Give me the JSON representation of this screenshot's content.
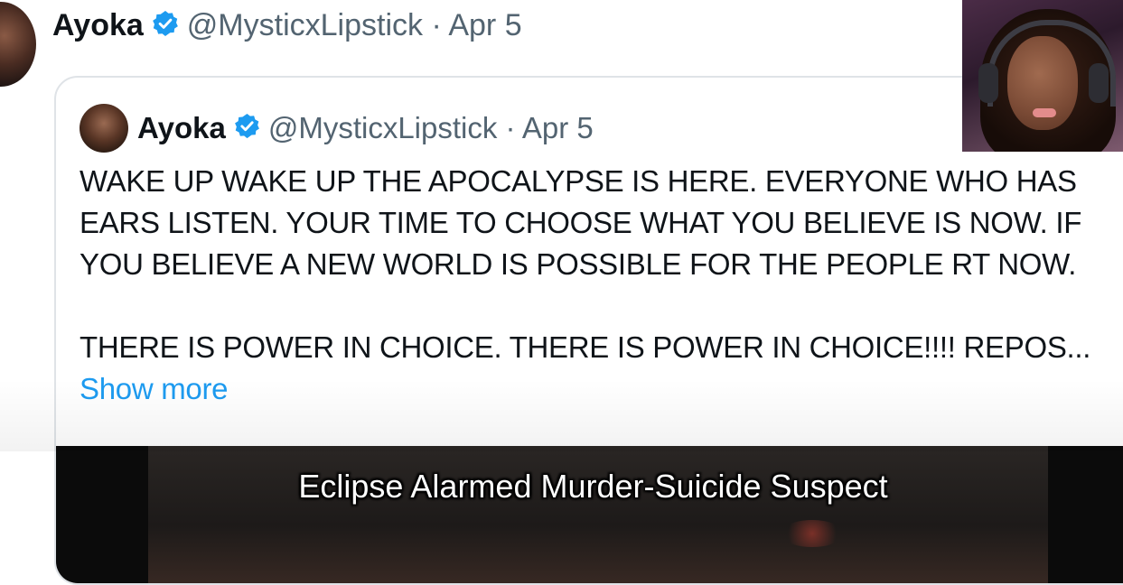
{
  "outer_tweet": {
    "name": "Ayoka",
    "handle_date": "@MysticxLipstick · Apr 5",
    "verified_icon": "verified-badge-icon"
  },
  "quoted_tweet": {
    "name": "Ayoka",
    "handle_date": "@MysticxLipstick · Apr 5",
    "text_lines": [
      "WAKE UP WAKE UP THE APOCALYPSE IS HERE. EVERYONE WHO HAS",
      "EARS LISTEN. YOUR TIME TO CHOOSE WHAT YOU BELIEVE IS NOW. IF",
      "YOU BELIEVE A NEW WORLD IS POSSIBLE FOR THE PEOPLE RT NOW.",
      "THERE IS POWER IN CHOICE. THERE IS POWER IN CHOICE!!!! REPOS..."
    ],
    "show_more": "Show more"
  },
  "caption": "Eclipse Alarmed Murder-Suicide Suspect",
  "colors": {
    "accent_blue": "#1d9bf0",
    "text": "#0f1419",
    "secondary_text": "#536471",
    "card_border": "#dfe3e7"
  }
}
